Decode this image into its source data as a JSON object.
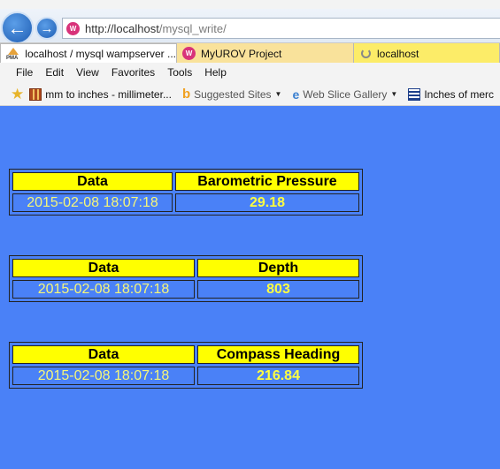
{
  "address": {
    "host": "http://localhost",
    "path": "/mysql_write/"
  },
  "tabs": [
    {
      "label": "localhost / mysql wampserver ..."
    },
    {
      "label": "MyUROV Project"
    },
    {
      "label": "localhost"
    }
  ],
  "menu": [
    "File",
    "Edit",
    "View",
    "Favorites",
    "Tools",
    "Help"
  ],
  "favorites": [
    {
      "label": "mm to inches - millimeter..."
    },
    {
      "label": "Suggested Sites"
    },
    {
      "label": "Web Slice Gallery"
    },
    {
      "label": "Inches of merc"
    }
  ],
  "tables": [
    {
      "col1": "Data",
      "col2": "Barometric Pressure",
      "date": "2015-02-08 18:07:18",
      "value": "29.18"
    },
    {
      "col1": "Data",
      "col2": "Depth",
      "date": "2015-02-08 18:07:18",
      "value": "803"
    },
    {
      "col1": "Data",
      "col2": "Compass Heading",
      "date": "2015-02-08 18:07:18",
      "value": "216.84"
    }
  ],
  "colors": {
    "page_bg": "#4a81f7",
    "header_bg": "#ffff00",
    "value_text": "#ffff40"
  }
}
